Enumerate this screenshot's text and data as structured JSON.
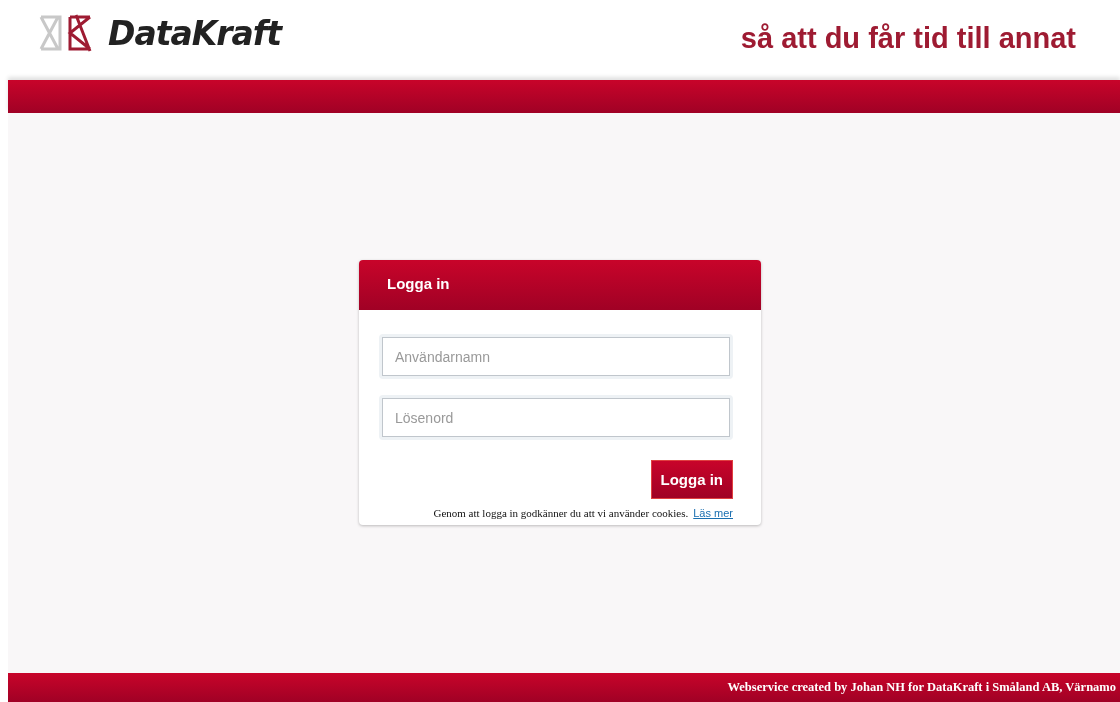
{
  "header": {
    "brand": "DataKraft",
    "tagline": "så att du får tid till annat"
  },
  "login": {
    "title": "Logga in",
    "username": {
      "placeholder": "Användarnamn"
    },
    "password": {
      "placeholder": "Lösenord"
    },
    "submit": "Logga in",
    "notice": "Genom att logga in godkänner du att vi använder cookies.",
    "notice_link": "Läs mer"
  },
  "footer": {
    "text": "Webservice created by Johan NH for DataKraft i Småland AB, Värnamo"
  }
}
